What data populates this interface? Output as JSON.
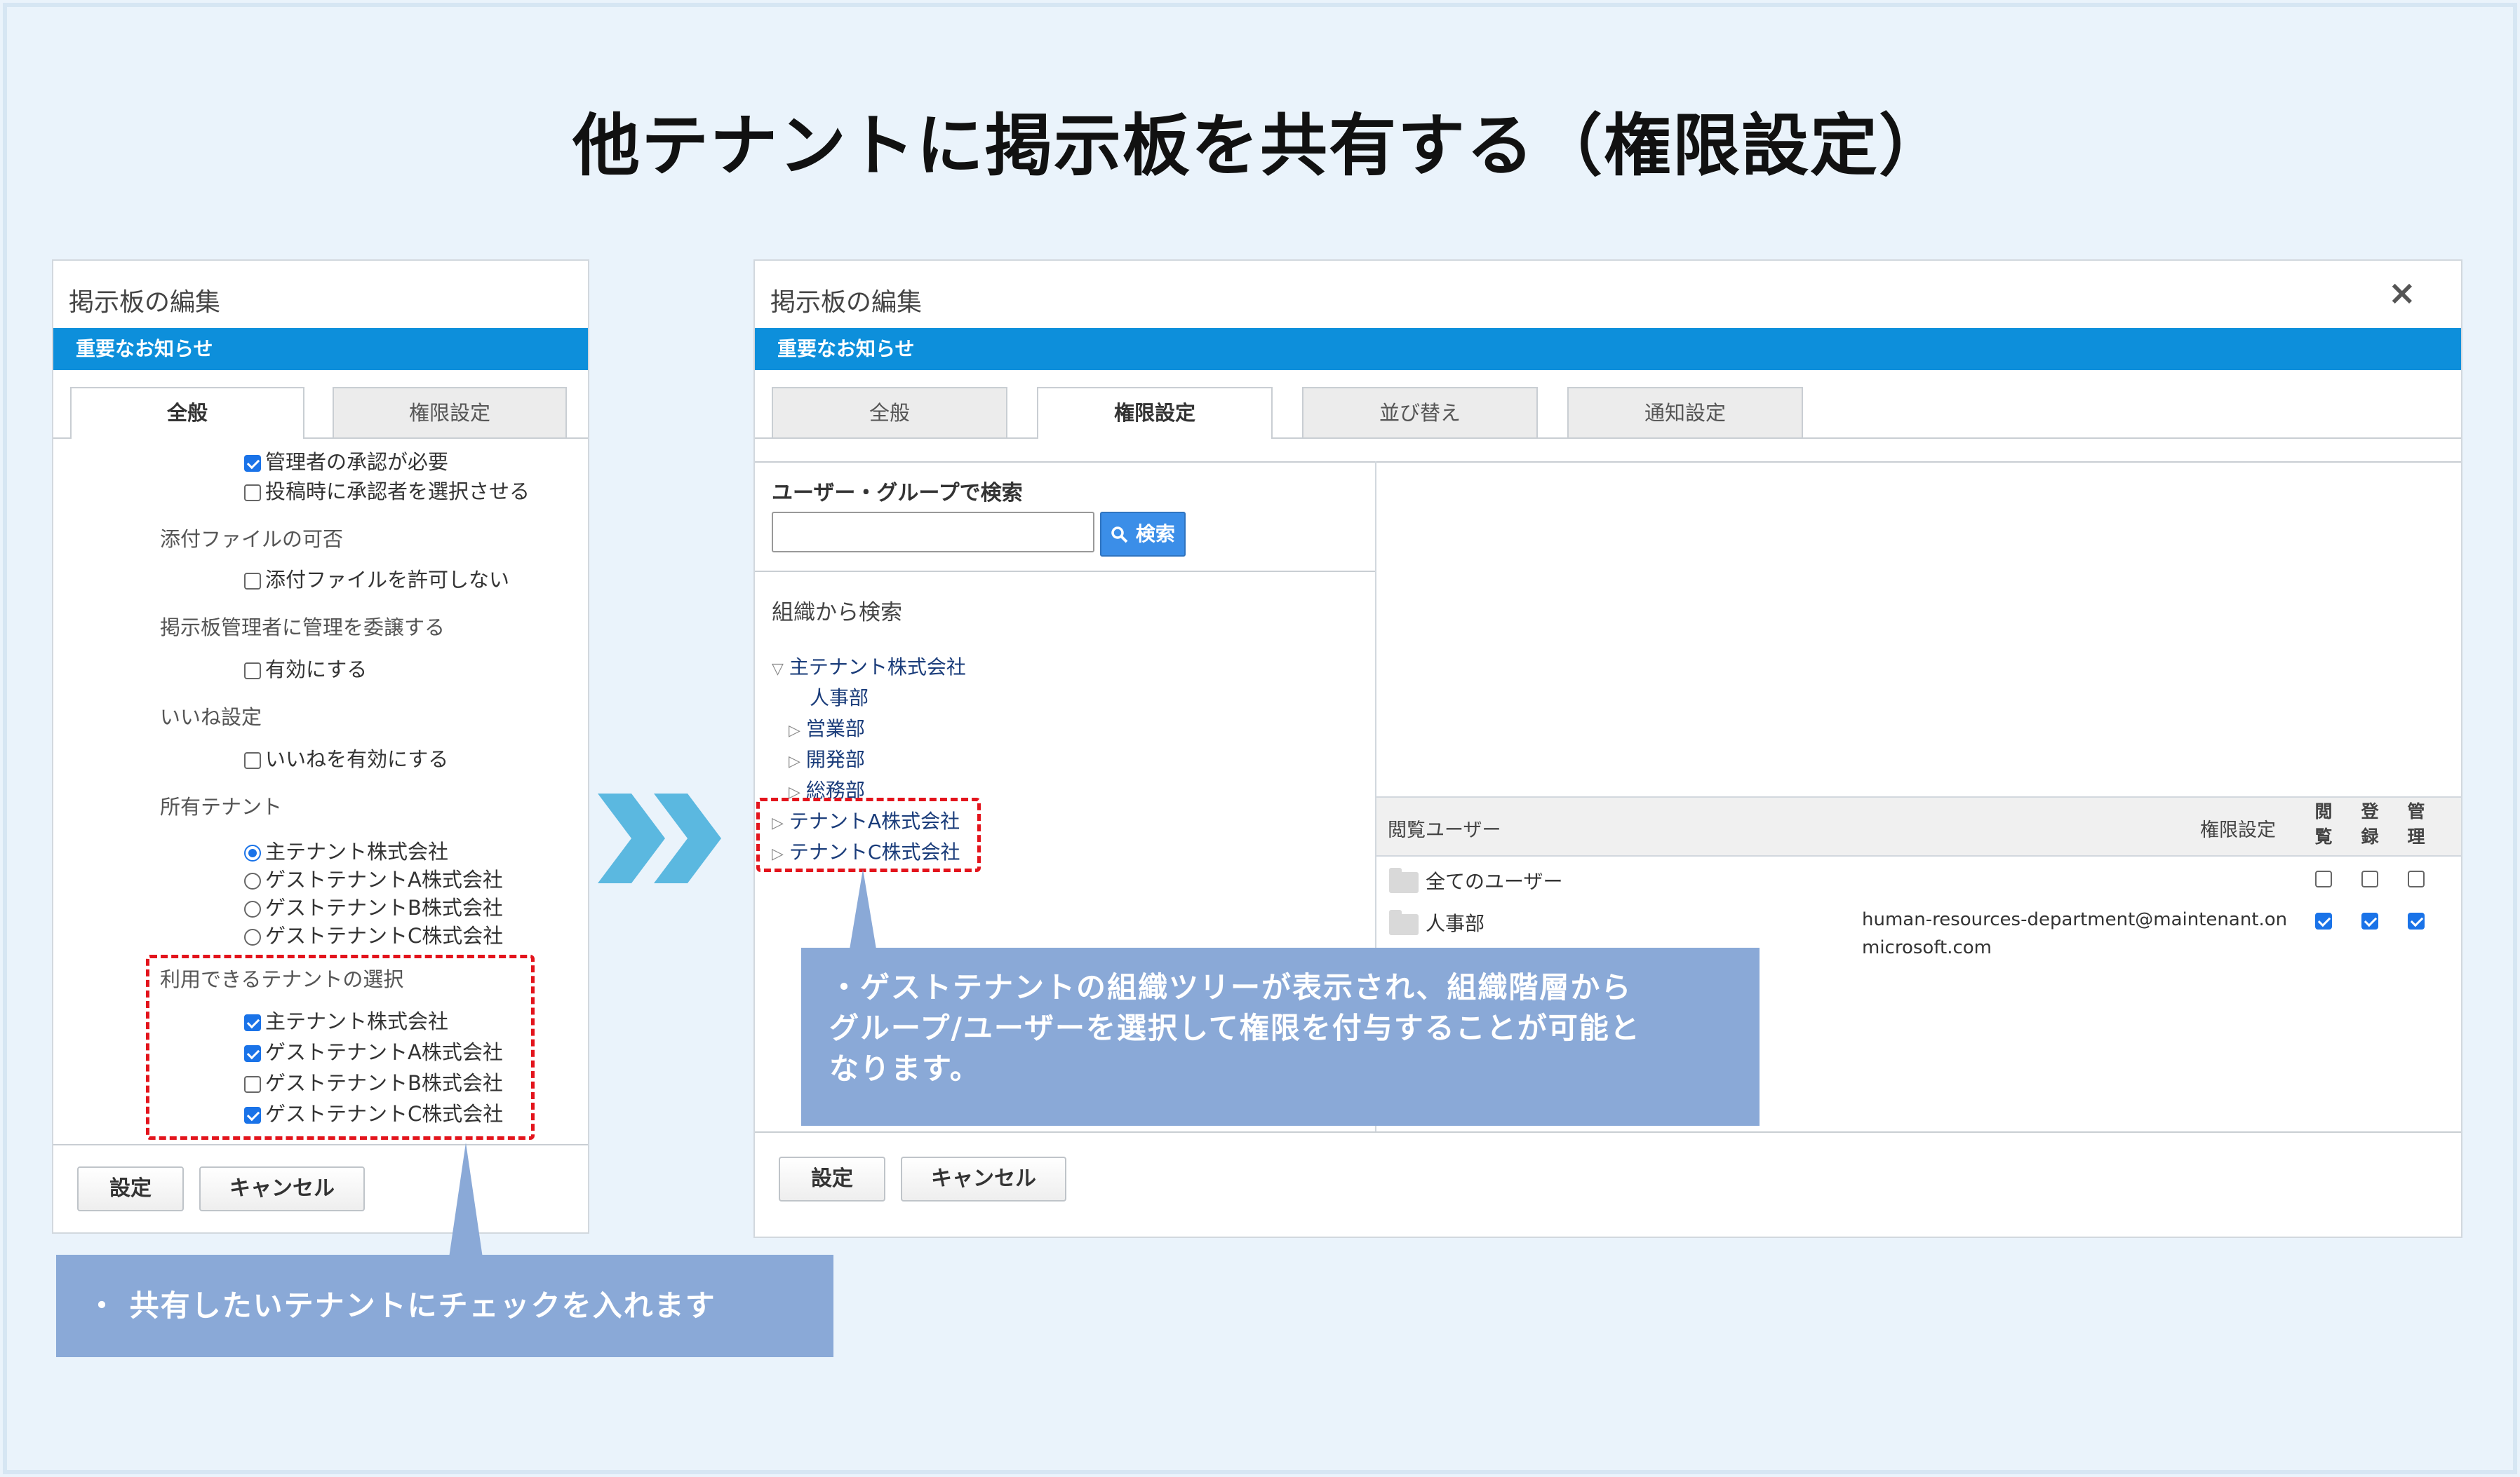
{
  "title": "他テナントに掲示板を共有する（権限設定）",
  "left_panel": {
    "title": "掲示板の編集",
    "notice": "重要なお知らせ",
    "tabs": [
      "全般",
      "権限設定"
    ],
    "approval_required": "管理者の承認が必要",
    "select_approver": "投稿時に承認者を選択させる",
    "attachment_label": "添付ファイルの可否",
    "attachment_disallow": "添付ファイルを許可しない",
    "delegate_label": "掲示板管理者に管理を委譲する",
    "delegate_enable": "有効にする",
    "like_label": "いいね設定",
    "like_enable": "いいねを有効にする",
    "owner_label": "所有テナント",
    "owner_options": [
      "主テナント株式会社",
      "ゲストテナントA株式会社",
      "ゲストテナントB株式会社",
      "ゲストテナントC株式会社"
    ],
    "available_label": "利用できるテナントの選択",
    "available_options": [
      "主テナント株式会社",
      "ゲストテナントA株式会社",
      "ゲストテナントB株式会社",
      "ゲストテナントC株式会社"
    ],
    "buttons": {
      "set": "設定",
      "cancel": "キャンセル"
    }
  },
  "right_panel": {
    "title": "掲示板の編集",
    "close_glyph": "×",
    "notice": "重要なお知らせ",
    "tabs": [
      "全般",
      "権限設定",
      "並び替え",
      "通知設定"
    ],
    "search_label": "ユーザー・グループで検索",
    "search_value": "",
    "search_button": "検索",
    "org_label": "組織から検索",
    "tree": [
      "主テナント株式会社",
      "人事部",
      "営業部",
      "開発部",
      "総務部",
      "テナントA株式会社",
      "テナントC株式会社"
    ],
    "table": {
      "col_user": "閲覧ユーザー",
      "col_perm": "権限設定",
      "col_view": [
        "閲",
        "覧"
      ],
      "col_register": [
        "登",
        "録"
      ],
      "col_manage": [
        "管",
        "理"
      ],
      "rows": [
        {
          "name": "全てのユーザー",
          "email_1": "",
          "email_2": ""
        },
        {
          "name": "人事部",
          "email_1": "human-resources-department@maintenant.on",
          "email_2": "microsoft.com"
        }
      ]
    },
    "buttons": {
      "set": "設定",
      "cancel": "キャンセル"
    }
  },
  "callouts": {
    "right": [
      "・ゲストテナントの組織ツリーが表示され、組織階層から",
      "グループ/ユーザーを選択して権限を付与することが可能と",
      "なります。"
    ],
    "left": "・ 共有したいテナントにチェックを入れます"
  },
  "colors": {
    "accent": "#0d8fdb",
    "callout": "#8aa9d7",
    "highlight": "#e3141c",
    "chevron": "#5bb8e0"
  }
}
